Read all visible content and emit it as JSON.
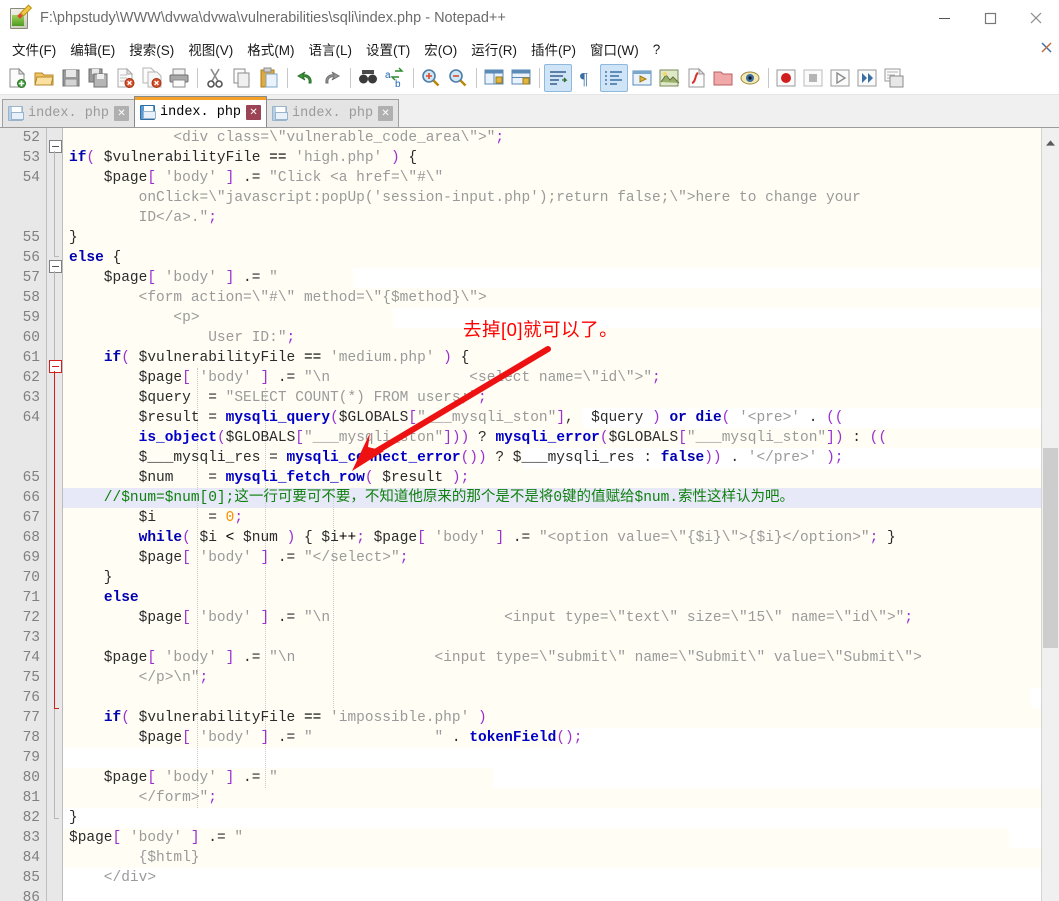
{
  "window": {
    "title": "F:\\phpstudy\\WWW\\dvwa\\dvwa\\vulnerabilities\\sqli\\index.php - Notepad++",
    "icon": "notepad-plus-plus-icon",
    "minimize_label": "–",
    "maximize_label": "□",
    "close_label": "✕"
  },
  "menu": {
    "items": [
      {
        "label": "文件(F)"
      },
      {
        "label": "编辑(E)"
      },
      {
        "label": "搜索(S)"
      },
      {
        "label": "视图(V)"
      },
      {
        "label": "格式(M)"
      },
      {
        "label": "语言(L)"
      },
      {
        "label": "设置(T)"
      },
      {
        "label": "宏(O)"
      },
      {
        "label": "运行(R)"
      },
      {
        "label": "插件(P)"
      },
      {
        "label": "窗口(W)"
      },
      {
        "label": "?"
      }
    ],
    "close_doc_label": "✕"
  },
  "toolbar": {
    "buttons": [
      {
        "name": "new-file-icon"
      },
      {
        "name": "open-file-icon"
      },
      {
        "name": "save-icon"
      },
      {
        "name": "save-all-icon"
      },
      {
        "name": "close-file-icon"
      },
      {
        "name": "close-all-icon"
      },
      {
        "name": "print-icon"
      },
      {
        "name": "separator"
      },
      {
        "name": "cut-icon"
      },
      {
        "name": "copy-icon"
      },
      {
        "name": "paste-icon"
      },
      {
        "name": "separator"
      },
      {
        "name": "undo-icon"
      },
      {
        "name": "redo-icon"
      },
      {
        "name": "separator"
      },
      {
        "name": "find-icon"
      },
      {
        "name": "replace-icon"
      },
      {
        "name": "separator"
      },
      {
        "name": "zoom-in-icon"
      },
      {
        "name": "zoom-out-icon"
      },
      {
        "name": "separator"
      },
      {
        "name": "sync-vertical-scroll-icon"
      },
      {
        "name": "sync-horizontal-scroll-icon"
      },
      {
        "name": "separator"
      },
      {
        "name": "word-wrap-icon"
      },
      {
        "name": "show-all-characters-icon"
      },
      {
        "name": "indent-guideline-icon"
      },
      {
        "name": "user-defined-language-icon"
      },
      {
        "name": "document-map-icon"
      },
      {
        "name": "function-list-icon"
      },
      {
        "name": "folder-as-workspace-icon"
      },
      {
        "name": "monitoring-icon"
      },
      {
        "name": "separator"
      },
      {
        "name": "macro-record-icon"
      },
      {
        "name": "macro-stop-icon"
      },
      {
        "name": "macro-play-icon"
      },
      {
        "name": "macro-run-multiple-icon"
      },
      {
        "name": "run-macro-dialog-icon"
      }
    ]
  },
  "tabs": [
    {
      "label": "index. php",
      "active": false,
      "icon": "save-disk-icon",
      "close": "✕"
    },
    {
      "label": "index. php",
      "active": true,
      "icon": "save-disk-icon",
      "close": "✕"
    },
    {
      "label": "index. php",
      "active": false,
      "icon": "save-disk-icon",
      "close": "✕"
    }
  ],
  "annotation": {
    "text": "去掉[0]就可以了。",
    "color": "#ff0000",
    "arrow": "red-arrow-pointing-to-line-65"
  },
  "editor": {
    "current_line": 66,
    "first_visible_line": 52,
    "last_visible_line": 86,
    "lines": [
      {
        "num": "52",
        "visual": 0
      },
      {
        "num": "53",
        "visual": 1
      },
      {
        "num": "54",
        "visual": 2
      },
      {
        "num": "",
        "visual": 3
      },
      {
        "num": "",
        "visual": 4
      },
      {
        "num": "55",
        "visual": 5
      },
      {
        "num": "56",
        "visual": 6
      },
      {
        "num": "57",
        "visual": 7
      },
      {
        "num": "58",
        "visual": 8
      },
      {
        "num": "59",
        "visual": 9
      },
      {
        "num": "60",
        "visual": 10
      },
      {
        "num": "61",
        "visual": 11
      },
      {
        "num": "62",
        "visual": 12
      },
      {
        "num": "63",
        "visual": 13
      },
      {
        "num": "64",
        "visual": 14
      },
      {
        "num": "",
        "visual": 15
      },
      {
        "num": "",
        "visual": 16
      },
      {
        "num": "65",
        "visual": 17
      },
      {
        "num": "66",
        "visual": 18
      },
      {
        "num": "67",
        "visual": 19
      },
      {
        "num": "68",
        "visual": 20
      },
      {
        "num": "69",
        "visual": 21
      },
      {
        "num": "70",
        "visual": 22
      },
      {
        "num": "71",
        "visual": 23
      },
      {
        "num": "72",
        "visual": 24
      },
      {
        "num": "73",
        "visual": 25
      },
      {
        "num": "74",
        "visual": 26
      },
      {
        "num": "75",
        "visual": 27
      },
      {
        "num": "76",
        "visual": 28
      },
      {
        "num": "77",
        "visual": 29
      },
      {
        "num": "78",
        "visual": 30
      },
      {
        "num": "79",
        "visual": 31
      },
      {
        "num": "80",
        "visual": 32
      },
      {
        "num": "81",
        "visual": 33
      },
      {
        "num": "82",
        "visual": 34
      },
      {
        "num": "83",
        "visual": 35
      },
      {
        "num": "84",
        "visual": 36
      },
      {
        "num": "85",
        "visual": 37
      },
      {
        "num": "86",
        "visual": 38
      }
    ],
    "source_text": [
      "            <div class=\\\"vulnerable_code_area\\\">\";",
      "if( $vulnerabilityFile == 'high.php' ) {",
      "    $page[ 'body' ] .= \"Click <a href=\\\"#\\\"",
      "        onClick=\\\"javascript:popUp('session-input.php');return false;\\\">here to change your",
      "        ID</a>.\";",
      "}",
      "else {",
      "    $page[ 'body' ] .= \"",
      "        <form action=\\\"#\\\" method=\\\"{$method}\\\">",
      "            <p>",
      "                User ID:\";",
      "    if( $vulnerabilityFile == 'medium.php' ) {",
      "        $page[ 'body' ] .= \"\\n                <select name=\\\"id\\\">\";",
      "        $query  = \"SELECT COUNT(*) FROM users;\";",
      "        $result = mysqli_query($GLOBALS[\"___mysqli_ston\"],  $query ) or die( '<pre>' . ((",
      "        is_object($GLOBALS[\"___mysqli_ston\"])) ? mysqli_error($GLOBALS[\"___mysqli_ston\"]) : ((",
      "        $___mysqli_res = mysqli_connect_error()) ? $___mysqli_res : false)) . '</pre>' );",
      "        $num    = mysqli_fetch_row( $result );",
      "    //$num=$num[0];这一行可要可不要，不知道他原来的那个是不是将0键的值赋给$num.索性这样认为吧。",
      "        $i      = 0;",
      "        while( $i < $num ) { $i++; $page[ 'body' ] .= \"<option value=\\\"{$i}\\\">{$i}</option>\"; }",
      "        $page[ 'body' ] .= \"</select>\";",
      "    }",
      "    else",
      "        $page[ 'body' ] .= \"\\n                    <input type=\\\"text\\\" size=\\\"15\\\" name=\\\"id\\\">\";",
      "",
      "    $page[ 'body' ] .= \"\\n                <input type=\\\"submit\\\" name=\\\"Submit\\\" value=\\\"Submit\\\">",
      "        </p>\\n\";",
      "",
      "    if( $vulnerabilityFile == 'impossible.php' )",
      "        $page[ 'body' ] .= \"              \" . tokenField();",
      "",
      "    $page[ 'body' ] .= \"",
      "        </form>\";",
      "}",
      "$page[ 'body' ] .= \"",
      "        {$html}",
      "    </div>",
      ""
    ]
  },
  "scrollbars": {
    "vertical_up_arrow": "▲",
    "vertical_down_arrow": "▼"
  }
}
